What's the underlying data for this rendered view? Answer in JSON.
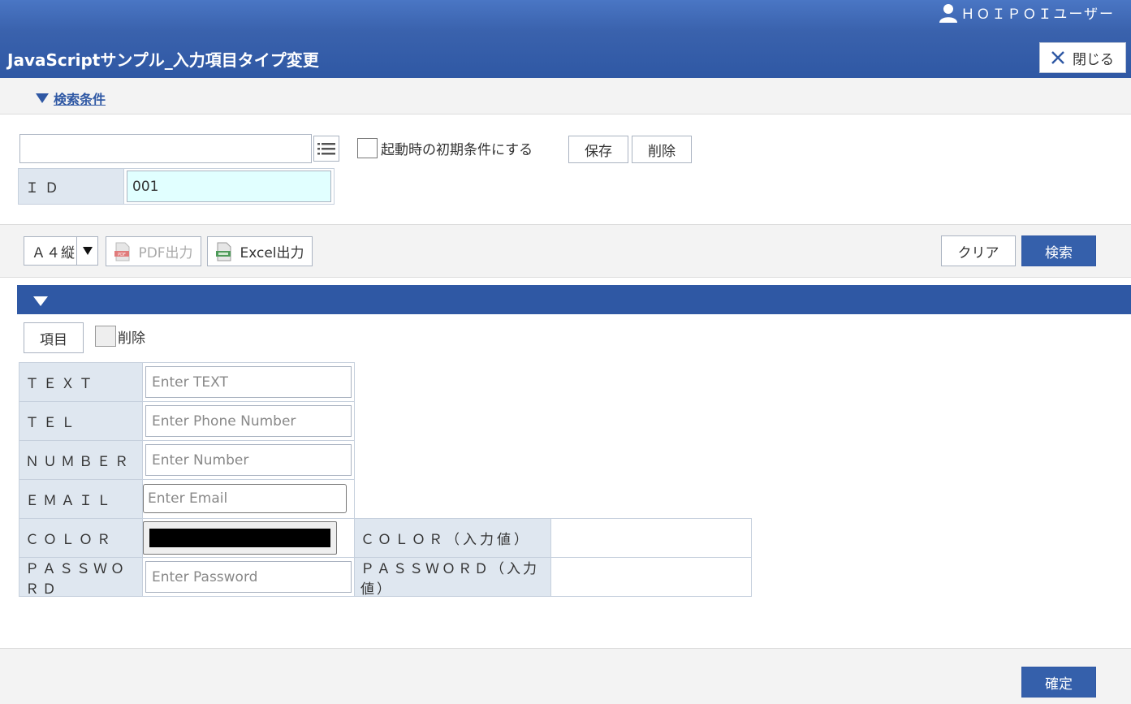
{
  "header": {
    "user_name": "ＨＯＩＰＯＩユーザー",
    "title": "JavaScriptサンプル_入力項目タイプ変更",
    "close_label": "閉じる"
  },
  "search_conditions": {
    "toggle_label": "検索条件",
    "condition_name_value": "",
    "default_checkbox_label": "起動時の初期条件にする",
    "default_checked": false,
    "save_label": "保存",
    "delete_label": "削除",
    "id_label": "ＩＤ",
    "id_value": "001"
  },
  "toolbar": {
    "paper_size": "Ａ４縦",
    "pdf_label": "PDF出力",
    "excel_label": "Excel出力",
    "clear_label": "クリア",
    "search_label": "検索"
  },
  "detail": {
    "item_button_label": "項目",
    "delete_checkbox_label": "削除",
    "delete_checked": false,
    "rows": {
      "text": {
        "label": "ＴＥＸＴ",
        "placeholder": "Enter TEXT"
      },
      "tel": {
        "label": "ＴＥＬ",
        "placeholder": "Enter Phone Number"
      },
      "number": {
        "label": "ＮＵＭＢＥＲ",
        "placeholder": "Enter Number"
      },
      "email": {
        "label": "ＥＭＡＩＬ",
        "placeholder": "Enter Email"
      },
      "color": {
        "label": "ＣＯＬＯＲ",
        "value": "#000000",
        "echo_label": "ＣＯＬＯＲ（入力値）",
        "echo_value": ""
      },
      "password": {
        "label": "ＰＡＳＳＷＯＲＤ",
        "placeholder": "Enter Password",
        "echo_label": "ＰＡＳＳＷＯＲＤ（入力値）",
        "echo_value": ""
      }
    }
  },
  "footer": {
    "confirm_label": "確定"
  },
  "colors": {
    "header_blue": "#2f58a4",
    "primary_button": "#3560ab",
    "label_bg": "#dfe7f0",
    "id_input_bg": "#e1ffff"
  },
  "icons": {
    "user": "user-icon",
    "close": "close-x-icon",
    "list": "list-icon",
    "pdf": "pdf-file-icon",
    "excel": "excel-file-icon"
  }
}
